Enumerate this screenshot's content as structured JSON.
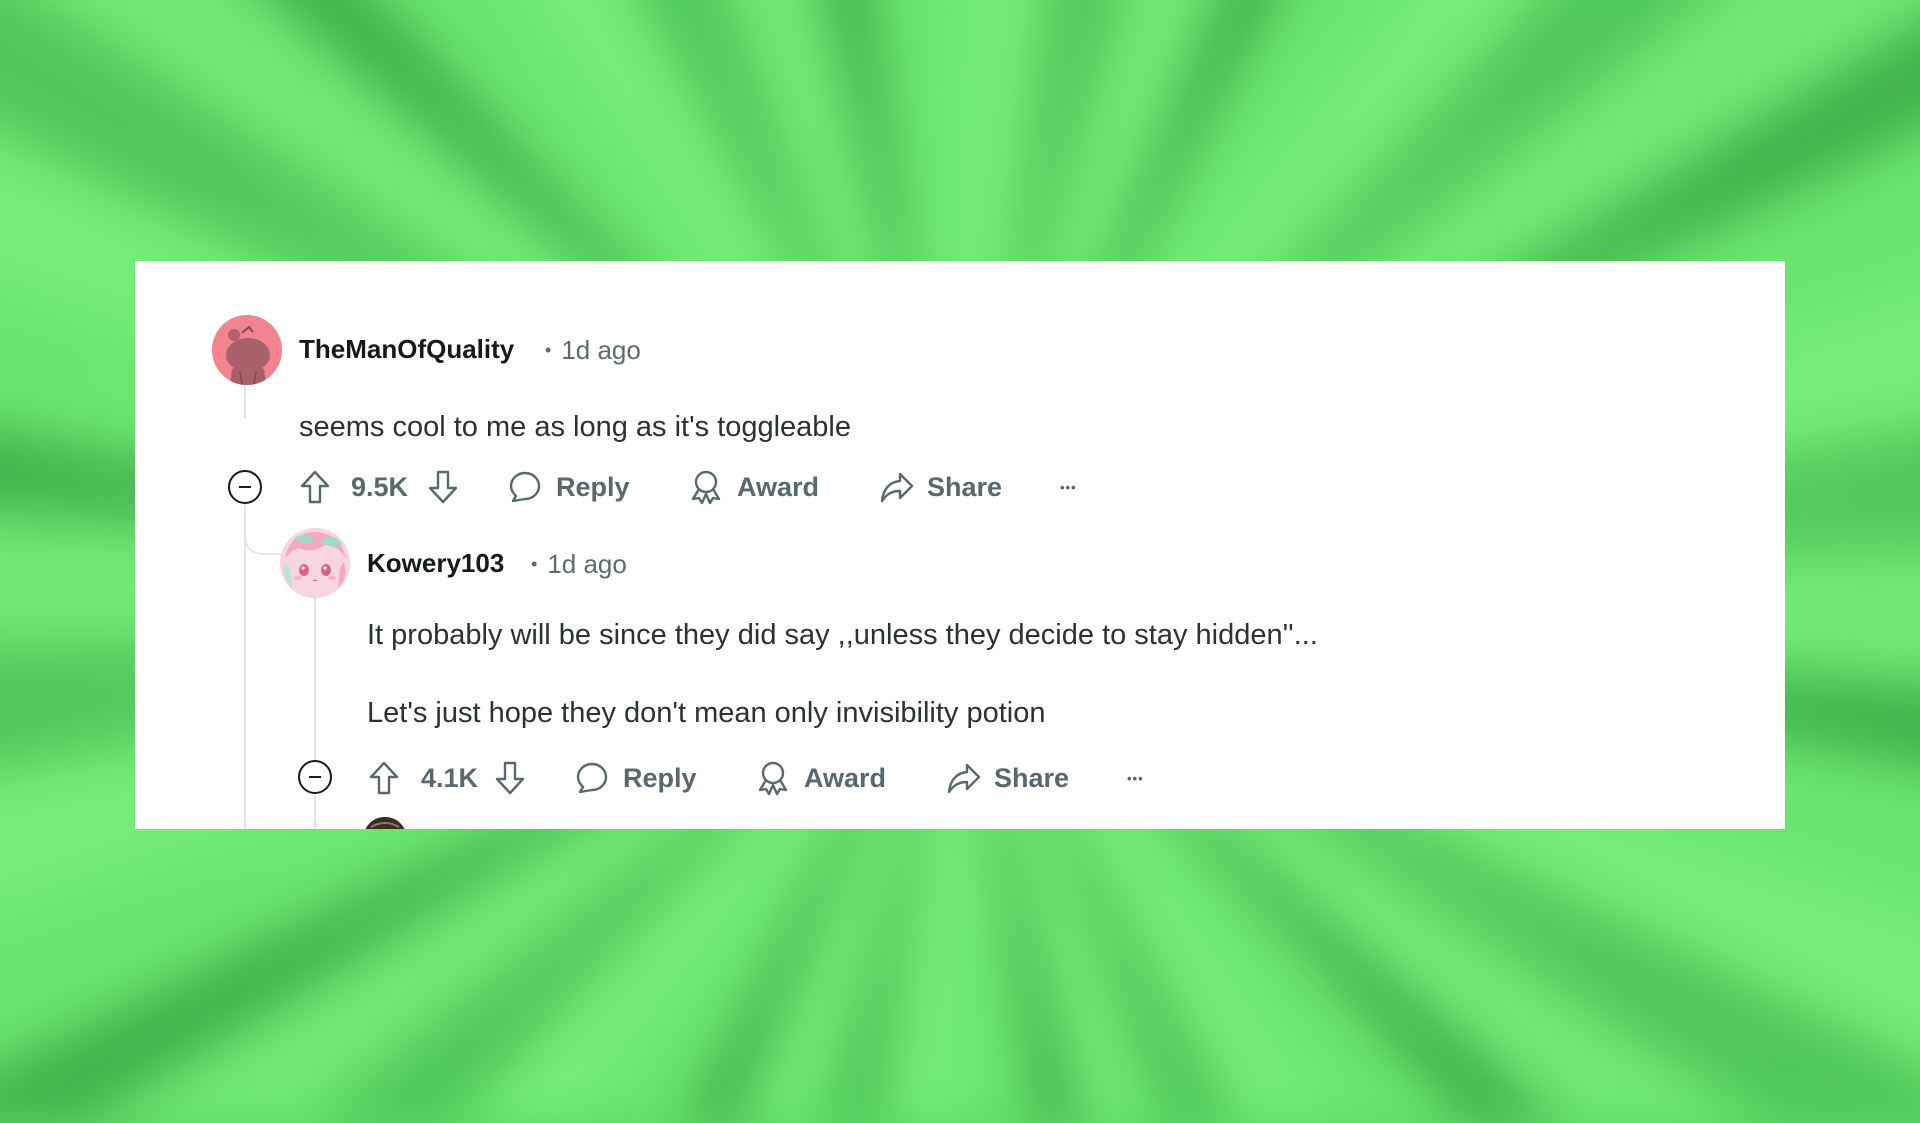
{
  "comments": [
    {
      "username": "TheManOfQuality",
      "separator": "•",
      "timestamp": "1d ago",
      "avatar_icon": "snoo-avatar-icon",
      "avatar_color": "#f2848f",
      "body": [
        "seems cool to me as long as it's toggleable"
      ],
      "score": "9.5K",
      "actions": {
        "reply": "Reply",
        "award": "Award",
        "share": "Share",
        "more": "•••"
      }
    },
    {
      "username": "Kowery103",
      "separator": "•",
      "timestamp": "1d ago",
      "avatar_icon": "anime-character-avatar-icon",
      "body": [
        "It probably will be since they did say ,,unless they decide to stay hidden''...",
        "Let's just hope they don't mean only invisibility potion"
      ],
      "score": "4.1K",
      "actions": {
        "reply": "Reply",
        "award": "Award",
        "share": "Share",
        "more": "•••"
      }
    }
  ],
  "colors": {
    "text_primary": "#141a1d",
    "text_body": "#2a3236",
    "text_meta": "#5c6c74",
    "action_gray": "#576870",
    "thread_line": "#e3e6e8",
    "background_green": "#5cd866"
  }
}
